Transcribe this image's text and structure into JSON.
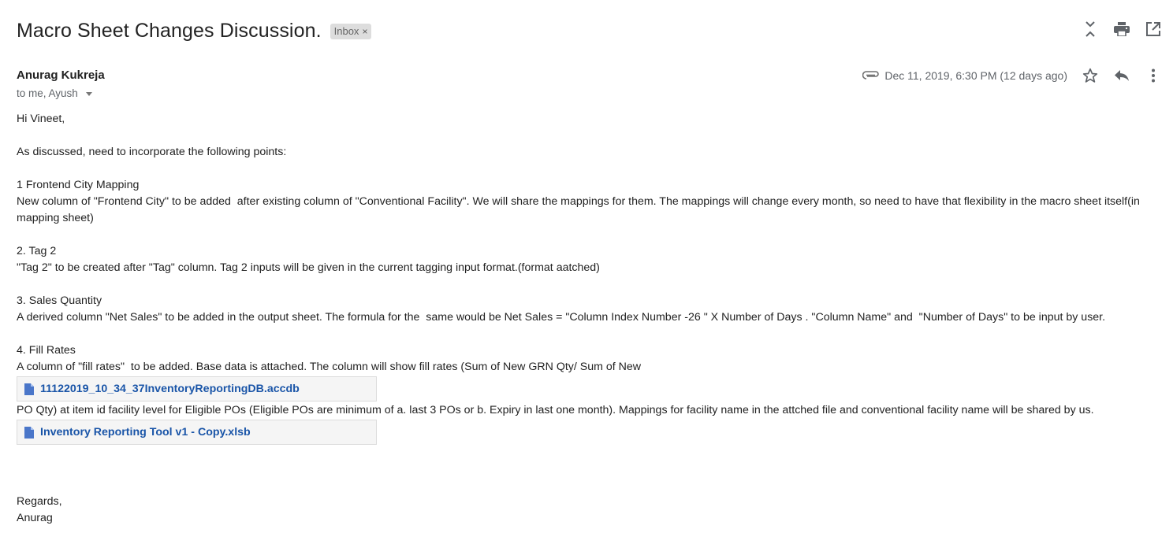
{
  "header": {
    "subject": "Macro Sheet Changes Discussion.",
    "label_chip": "Inbox",
    "label_chip_close": "×"
  },
  "message": {
    "sender": "Anurag Kukreja",
    "recipients": "to me, Ayush",
    "date": "Dec 11, 2019, 6:30 PM (12 days ago)",
    "body": {
      "greeting": "Hi Vineet,",
      "intro": "As discussed, need to incorporate the following points:",
      "point1_title": "1 Frontend City Mapping",
      "point1_text": "New column of \"Frontend City\" to be added  after existing column of \"Conventional Facility\". We will share the mappings for them. The mappings will change every month, so need to have that flexibility in the macro sheet itself(in mapping sheet)",
      "point2_title": "2. Tag 2",
      "point2_text": "\"Tag 2\" to be created after \"Tag\" column. Tag 2 inputs will be given in the current tagging input format.(format aatched)",
      "point3_title": "3. Sales Quantity",
      "point3_text": "A derived column \"Net Sales\" to be added in the output sheet. The formula for the  same would be Net Sales = \"Column Index Number -26 \" X Number of Days . \"Column Name\" and  \"Number of Days\" to be input by user.",
      "point4_title": "4. Fill Rates",
      "point4_text_a": "A column of \"fill rates\"  to be added. Base data is attached. The column will show fill rates (Sum of New GRN Qty/ Sum of New",
      "point4_text_b": "PO Qty) at item id facility level for Eligible POs (Eligible POs are minimum of a. last 3 POs or b. Expiry in last one month). Mappings for facility name in the attched file and conventional facility name will be shared by us."
    },
    "attachments": [
      {
        "name": "11122019_10_34_37InventoryReportingDB.accdb",
        "icon": "file-icon"
      },
      {
        "name": "Inventory Reporting Tool v1 - Copy.xlsb",
        "icon": "file-icon"
      }
    ],
    "signoff": {
      "line1": "Regards,",
      "line2": "Anurag"
    }
  },
  "icons": {
    "expand": "unfold-icon",
    "print": "print-icon",
    "popout": "open-in-new-icon",
    "attachment": "paperclip-icon",
    "star": "star-icon",
    "reply": "reply-icon",
    "more": "more-vert-icon"
  },
  "colors": {
    "link": "#1a55a8",
    "muted": "#5f6368",
    "chip_bg": "#dddddd",
    "attachment_bg": "#f5f5f5"
  }
}
